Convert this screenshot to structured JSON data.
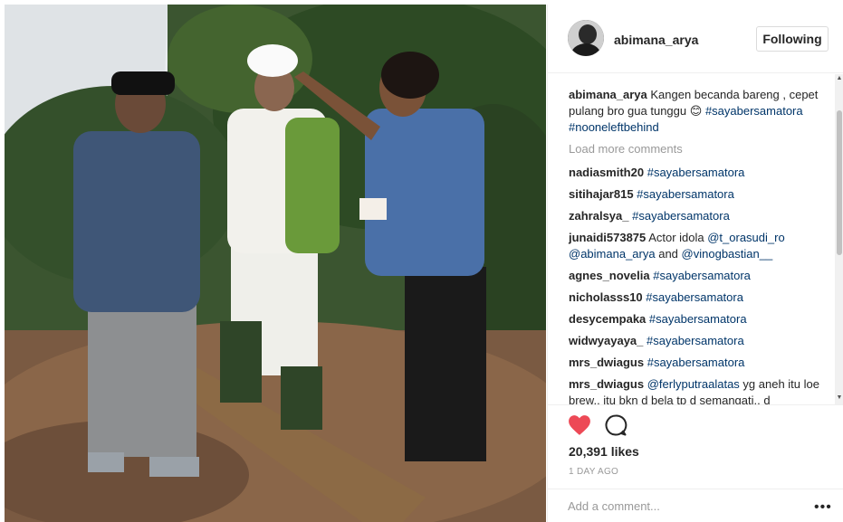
{
  "post": {
    "image_alt": "",
    "author": "abimana_arya",
    "follow_label": "Following",
    "caption": {
      "user": "abimana_arya",
      "text": "Kangen becanda bareng , cepet pulang bro gua tunggu",
      "emoji": "😊",
      "tags": "#sayabersamatora #nooneleftbehind"
    },
    "load_more": "Load more comments",
    "comments": [
      {
        "user": "nadiasmith20",
        "text": "#sayabersamatora"
      },
      {
        "user": "sitihajar815",
        "text": "#sayabersamatora"
      },
      {
        "user": "zahralsya_",
        "text": "#sayabersamatora"
      },
      {
        "user": "junaidi573875",
        "text": "Actor idola",
        "mention1": "@t_orasudi_ro",
        "mention2": "@abimana_arya",
        "and": "and",
        "mention3": "@vinogbastian__"
      },
      {
        "user": "agnes_novelia",
        "text": "#sayabersamatora"
      },
      {
        "user": "nicholasss10",
        "text": "#sayabersamatora"
      },
      {
        "user": "desycempaka",
        "text": "#sayabersamatora"
      },
      {
        "user": "widwyayaya_",
        "text": "#sayabersamatora"
      },
      {
        "user": "mrs_dwiagus",
        "text": "#sayabersamatora"
      },
      {
        "user": "mrs_dwiagus",
        "mention": "@ferlyputraalatas",
        "text": "yg aneh itu loe brew.. itu bkn d bela tp d semangati.. d"
      }
    ],
    "likes": "20,391 likes",
    "timestamp": "1 DAY AGO",
    "add_comment_placeholder": "Add a comment...",
    "more_label": "•••"
  },
  "icons": {
    "heart": "heart-icon",
    "comment": "comment-bubble-icon",
    "more": "more-options-icon"
  },
  "colors": {
    "heart": "#ed4956",
    "link": "#003569",
    "muted": "#999999"
  }
}
